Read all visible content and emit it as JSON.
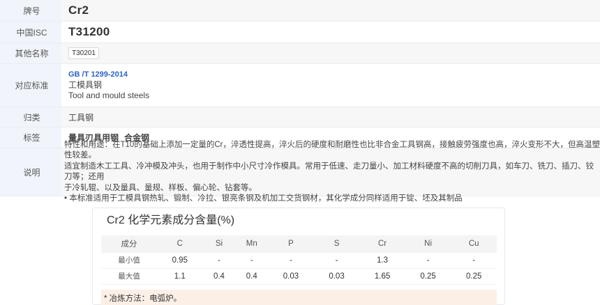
{
  "info": {
    "grade": {
      "label": "牌号",
      "value": "Cr2"
    },
    "isc": {
      "label": "中国ISC",
      "value": "T31200"
    },
    "alias": {
      "label": "其他名称",
      "value": "T30201"
    },
    "standard": {
      "label": "对应标准",
      "code": "GB /T 1299-2014",
      "name_cn": "工模具钢",
      "name_en": "Tool and mould steels"
    },
    "category": {
      "label": "归类",
      "value": "工具钢"
    },
    "tags": {
      "label": "标签",
      "items": [
        "量具刃具用钢",
        "合金钢"
      ]
    },
    "description": {
      "label": "说明",
      "lines": [
        "特性和用途：在T10的基础上添加一定量的Cr，淬透性提高，淬火后的硬度和耐磨性也比非合金工具钢高，接触疲劳强度也高，淬火变形不大，但高温塑性较差。",
        "适宜制造木工工具、冷冲模及冲头，也用于制作中小尺寸冷作模具。常用于低速、走刀量小、加工材料硬度不高的切削刀具，如车刀、铣刀、插刀、铰刀等；还用",
        "于冷轧辊、以及量具、量规、样板、偏心轮、钻套等。",
        "• 本标准适用于工模具钢热轧、锻制、冷拉、银亮条钢及机加工交货钢材，其化学成分同样适用于锭、坯及其制品"
      ]
    }
  },
  "chem": {
    "title": "Cr2 化学元素成分含量(%)",
    "header": [
      "成分",
      "C",
      "Si",
      "Mn",
      "P",
      "S",
      "Cr",
      "Ni",
      "Cu"
    ],
    "rows": [
      [
        "最小值",
        "0.95",
        "-",
        "-",
        "-",
        "-",
        "1.3",
        "-",
        "-"
      ],
      [
        "最大值",
        "1.1",
        "0.4",
        "0.4",
        "0.03",
        "0.03",
        "1.65",
        "0.25",
        "0.25"
      ]
    ],
    "note": "* 冶炼方法：电弧炉。"
  },
  "colors": {
    "label_bg": "#f1f5fb",
    "link": "#2b63c9",
    "note_bg": "#fcefe6"
  }
}
